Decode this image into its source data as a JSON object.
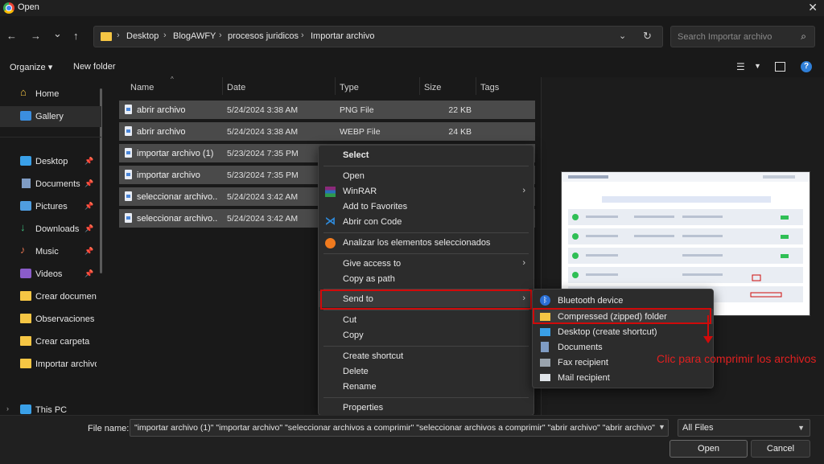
{
  "window": {
    "title": "Open",
    "close_glyph": "✕"
  },
  "nav": {
    "back": "←",
    "forward": "→",
    "recent": "⌄",
    "up": "↑",
    "breadcrumbs": [
      "Desktop",
      "BlogAWFY",
      "procesos juridicos",
      "Importar archivo"
    ],
    "sep": "›",
    "search_placeholder": "Search Importar archivo"
  },
  "toolbar": {
    "organize": "Organize ▾",
    "new_folder": "New folder"
  },
  "sidebar": {
    "items": [
      {
        "label": "Home",
        "icon": "home-icon"
      },
      {
        "label": "Gallery",
        "icon": "gallery-icon"
      },
      {
        "label": "Desktop",
        "icon": "desktop-icon"
      },
      {
        "label": "Documents",
        "icon": "documents-icon"
      },
      {
        "label": "Pictures",
        "icon": "pictures-icon"
      },
      {
        "label": "Downloads",
        "icon": "downloads-icon"
      },
      {
        "label": "Music",
        "icon": "music-icon"
      },
      {
        "label": "Videos",
        "icon": "videos-icon"
      },
      {
        "label": "Crear documento",
        "icon": "folder-icon"
      },
      {
        "label": "Observaciones",
        "icon": "folder-icon"
      },
      {
        "label": "Crear carpeta",
        "icon": "folder-icon"
      },
      {
        "label": "Importar archivo",
        "icon": "folder-icon"
      },
      {
        "label": "This PC",
        "icon": "pc-icon"
      }
    ]
  },
  "columns": {
    "name": "Name",
    "date": "Date",
    "type": "Type",
    "size": "Size",
    "tags": "Tags"
  },
  "files": [
    {
      "name": "abrir archivo",
      "date": "5/24/2024 3:38 AM",
      "type": "PNG File",
      "size": "22 KB"
    },
    {
      "name": "abrir archivo",
      "date": "5/24/2024 3:38 AM",
      "type": "WEBP File",
      "size": "24 KB"
    },
    {
      "name": "importar archivo (1)",
      "date": "5/23/2024 7:35 PM",
      "type": "",
      "size": ""
    },
    {
      "name": "importar archivo",
      "date": "5/23/2024 7:35 PM",
      "type": "",
      "size": ""
    },
    {
      "name": "seleccionar archivo...",
      "date": "5/24/2024 3:42 AM",
      "type": "",
      "size": ""
    },
    {
      "name": "seleccionar archivo...",
      "date": "5/24/2024 3:42 AM",
      "type": "",
      "size": ""
    }
  ],
  "context_menu": {
    "select": "Select",
    "open": "Open",
    "winrar": "WinRAR",
    "add_favorites": "Add to Favorites",
    "open_code": "Abrir con Code",
    "analyze": "Analizar los elementos seleccionados",
    "give_access": "Give access to",
    "copy_path": "Copy as path",
    "send_to": "Send to",
    "cut": "Cut",
    "copy": "Copy",
    "create_shortcut": "Create shortcut",
    "delete": "Delete",
    "rename": "Rename",
    "properties": "Properties",
    "arrow": "›"
  },
  "send_to_menu": {
    "bluetooth": "Bluetooth device",
    "zip": "Compressed (zipped) folder",
    "desktop": "Desktop (create shortcut)",
    "documents": "Documents",
    "fax": "Fax recipient",
    "mail": "Mail recipient"
  },
  "annotation": "Clic para comprimir los archivos",
  "footer": {
    "file_name_label": "File name:",
    "file_name_value": "\"importar archivo (1)\" \"importar archivo\" \"seleccionar archivos a comprimir\" \"seleccionar archivos a comprimir\" \"abrir archivo\" \"abrir archivo\"",
    "filter": "All Files",
    "open": "Open",
    "cancel": "Cancel"
  },
  "colors": {
    "highlight": "#d00a0a",
    "annotation": "#e02020",
    "selection": "#4a4a4a"
  }
}
